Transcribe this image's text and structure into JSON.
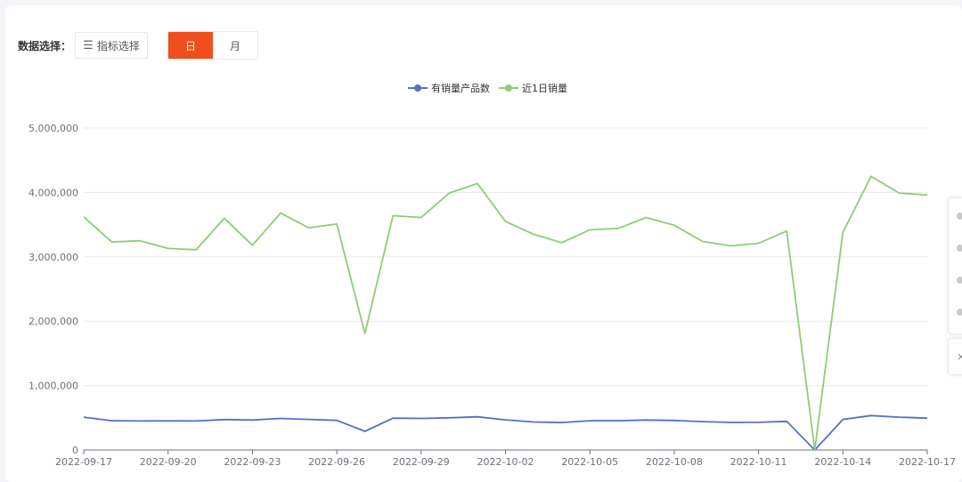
{
  "toolbar": {
    "label": "数据选择：",
    "metric_button": "指标选择",
    "toggle_day": "日",
    "toggle_month": "月"
  },
  "colors": {
    "accent": "#f04e1c",
    "series1": "#5470c6",
    "series2": "#91cc75"
  },
  "side_tools": {
    "close_icon": "×"
  },
  "chart_data": {
    "type": "line",
    "legend_position": "top-center",
    "grid": true,
    "ylim": [
      0,
      5000000
    ],
    "y_ticks": [
      0,
      1000000,
      2000000,
      3000000,
      4000000,
      5000000
    ],
    "y_tick_labels": [
      "0",
      "1,000,000",
      "2,000,000",
      "3,000,000",
      "4,000,000",
      "5,000,000"
    ],
    "x_tick_labels": [
      "2022-09-17",
      "2022-09-20",
      "2022-09-23",
      "2022-09-26",
      "2022-09-29",
      "2022-10-02",
      "2022-10-05",
      "2022-10-08",
      "2022-10-11",
      "2022-10-14",
      "2022-10-17"
    ],
    "x": [
      "2022-09-17",
      "2022-09-18",
      "2022-09-19",
      "2022-09-20",
      "2022-09-21",
      "2022-09-22",
      "2022-09-23",
      "2022-09-24",
      "2022-09-25",
      "2022-09-26",
      "2022-09-27",
      "2022-09-28",
      "2022-09-29",
      "2022-09-30",
      "2022-10-01",
      "2022-10-02",
      "2022-10-03",
      "2022-10-04",
      "2022-10-05",
      "2022-10-06",
      "2022-10-07",
      "2022-10-08",
      "2022-10-09",
      "2022-10-10",
      "2022-10-11",
      "2022-10-12",
      "2022-10-13",
      "2022-10-14",
      "2022-10-15",
      "2022-10-16",
      "2022-10-17"
    ],
    "series": [
      {
        "name": "有销量产品数",
        "color": "#5470c6",
        "values": [
          510000,
          455000,
          450000,
          452000,
          450000,
          472000,
          465000,
          490000,
          475000,
          460000,
          290000,
          495000,
          490000,
          500000,
          515000,
          468000,
          435000,
          425000,
          455000,
          455000,
          465000,
          458000,
          440000,
          428000,
          430000,
          445000,
          0,
          475000,
          535000,
          510000,
          495000
        ]
      },
      {
        "name": "近1日销量",
        "color": "#91cc75",
        "values": [
          3620000,
          3230000,
          3250000,
          3130000,
          3110000,
          3600000,
          3180000,
          3680000,
          3450000,
          3510000,
          1810000,
          3640000,
          3610000,
          3990000,
          4140000,
          3550000,
          3350000,
          3220000,
          3420000,
          3440000,
          3610000,
          3490000,
          3240000,
          3170000,
          3210000,
          3400000,
          0,
          3380000,
          4250000,
          3990000,
          3960000
        ]
      }
    ]
  }
}
